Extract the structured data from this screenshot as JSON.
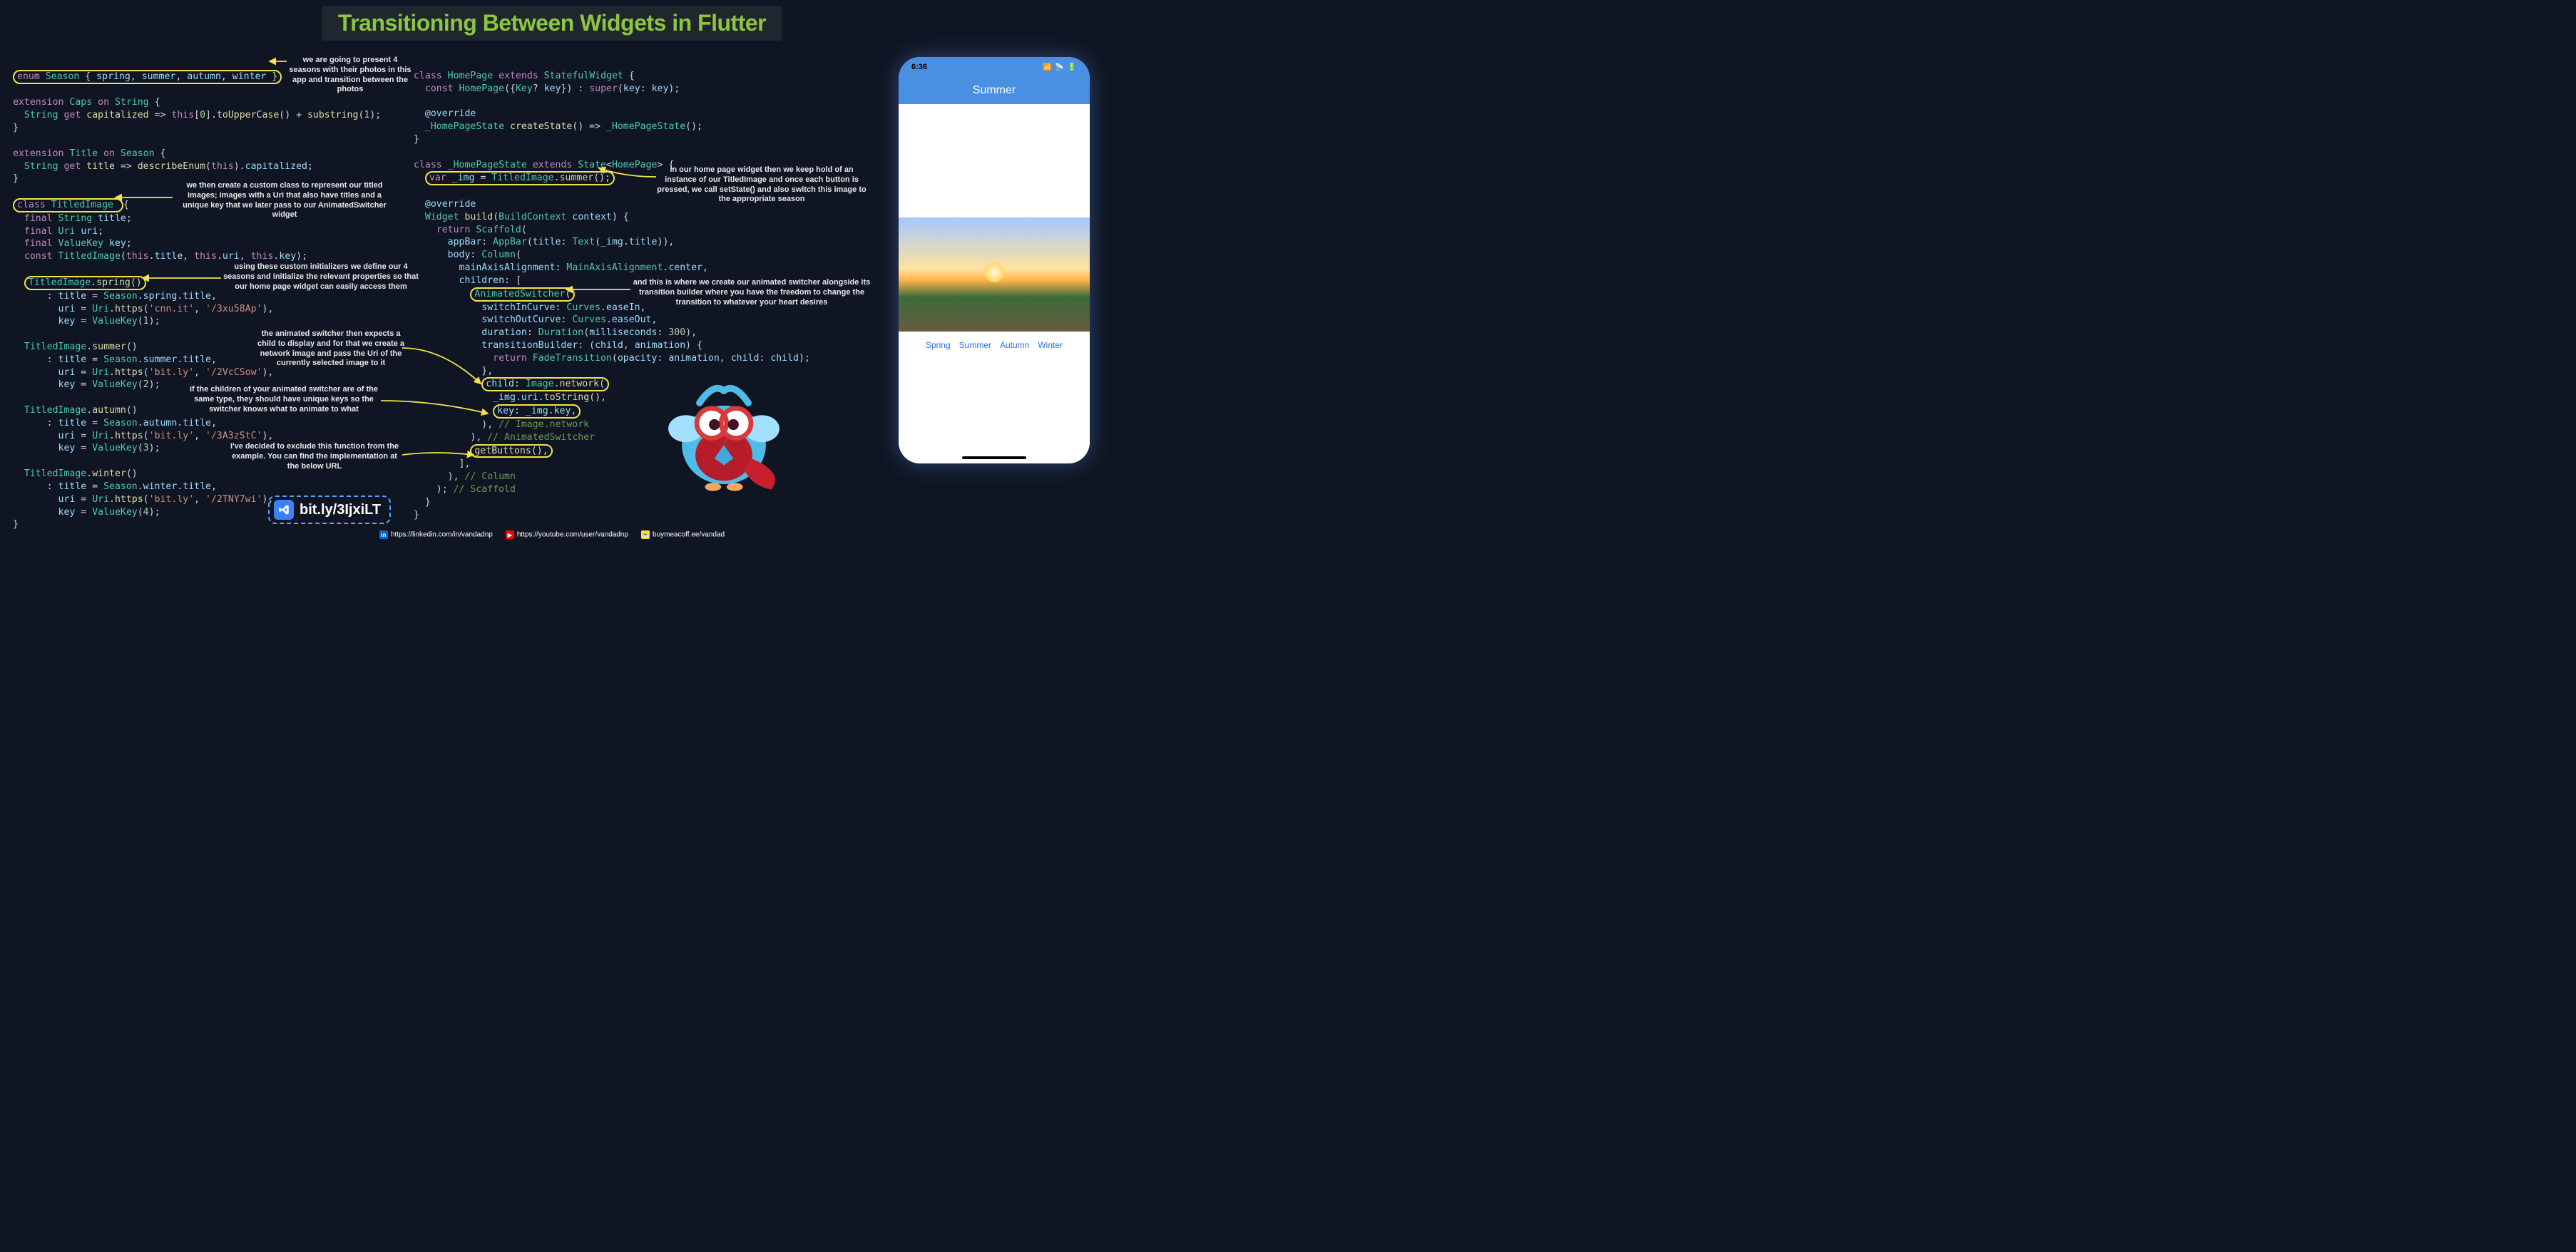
{
  "title": "Transitioning Between Widgets in Flutter",
  "annotations": {
    "a1": "we are going to present 4 seasons with their photos in this app and transition between the photos",
    "a2": "we then create a custom class to represent our titled images; images with a Uri that also have titles and a unique key that we later pass to our AnimatedSwitcher widget",
    "a3": "using these custom initializers we define our 4 seasons and initialize the relevant properties so that our home page widget can easily access them",
    "a4": "the animated switcher then expects a child to display and for that we create a network image and pass the Uri of the currently selected image to it",
    "a5": "if the children of your animated switcher are of the same type, they should have unique keys so the switcher knows what to animate to what",
    "a6": "I've decided to exclude this function from the example. You can find the implementation at the below URL",
    "a7": "in our home page widget then we keep hold of an instance of our TitledImage and once each button is pressed, we call setState() and also switch this image to the appropriate season",
    "a8": "and this is where we create our animated switcher alongside its transition builder where you have the freedom to change the transition to whatever your heart desires"
  },
  "vscode_link": "bit.ly/3IjxiLT",
  "footer": {
    "linkedin": "https://linkedin.com/in/vandadnp",
    "youtube": "https://youtube.com/user/vandadnp",
    "bmc": "buymeacoff.ee/vandad"
  },
  "phone": {
    "time": "6:36",
    "appbar_title": "Summer",
    "buttons": [
      "Spring",
      "Summer",
      "Autumn",
      "Winter"
    ]
  },
  "code_left": {
    "l1_enum": "enum Season { spring, summer, autumn, winter }",
    "l2": "extension Caps on String {",
    "l3": "  String get capitalized => this[0].toUpperCase() + substring(1);",
    "l4": "}",
    "l5": "extension Title on Season {",
    "l6": "  String get title => describeEnum(this).capitalized;",
    "l7": "}",
    "l8_class": "class TitledImage {",
    "l9": "  final String title;",
    "l10": "  final Uri uri;",
    "l11": "  final ValueKey key;",
    "l12": "  const TitledImage(this.title, this.uri, this.key);",
    "l13_spring": "  TitledImage.spring()",
    "l14": "      : title = Season.spring.title,",
    "l15": "        uri = Uri.https('cnn.it', '/3xu58Ap'),",
    "l16": "        key = ValueKey(1);",
    "l17": "  TitledImage.summer()",
    "l18": "      : title = Season.summer.title,",
    "l19": "        uri = Uri.https('bit.ly', '/2VcCSow'),",
    "l20": "        key = ValueKey(2);",
    "l21": "  TitledImage.autumn()",
    "l22": "      : title = Season.autumn.title,",
    "l23": "        uri = Uri.https('bit.ly', '/3A3zStC'),",
    "l24": "        key = ValueKey(3);",
    "l25": "  TitledImage.winter()",
    "l26": "      : title = Season.winter.title,",
    "l27": "        uri = Uri.https('bit.ly', '/2TNY7wi'),",
    "l28": "        key = ValueKey(4);",
    "l29": "}"
  },
  "code_right": {
    "r1": "class HomePage extends StatefulWidget {",
    "r2": "  const HomePage({Key? key}) : super(key: key);",
    "r3": "  @override",
    "r4": "  _HomePageState createState() => _HomePageState();",
    "r5": "}",
    "r6": "class _HomePageState extends State<HomePage> {",
    "r7_img": "  var _img = TitledImage.summer();",
    "r8": "  @override",
    "r9": "  Widget build(BuildContext context) {",
    "r10": "    return Scaffold(",
    "r11": "      appBar: AppBar(title: Text(_img.title)),",
    "r12": "      body: Column(",
    "r13": "        mainAxisAlignment: MainAxisAlignment.center,",
    "r14": "        children: [",
    "r15_switcher": "          AnimatedSwitcher(",
    "r16": "            switchInCurve: Curves.easeIn,",
    "r17": "            switchOutCurve: Curves.easeOut,",
    "r18": "            duration: Duration(milliseconds: 300),",
    "r19": "            transitionBuilder: (child, animation) {",
    "r20": "              return FadeTransition(opacity: animation, child: child);",
    "r21": "            },",
    "r22_child": "            child: Image.network(",
    "r23": "              _img.uri.toString(),",
    "r24_key": "              key: _img.key,",
    "r25": "            ), // Image.network",
    "r26": "          ), // AnimatedSwitcher",
    "r27_getbtn": "          getButtons(),",
    "r28": "        ],",
    "r29": "      ), // Column",
    "r30": "    ); // Scaffold",
    "r31": "  }",
    "r32": "}"
  }
}
